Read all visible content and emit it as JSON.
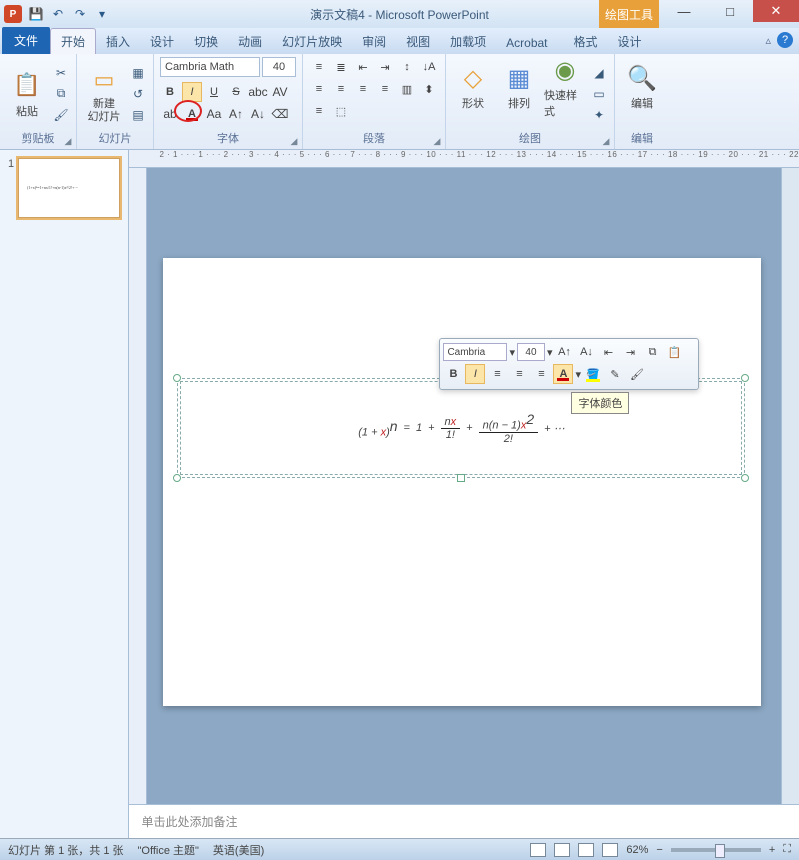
{
  "title": "演示文稿4 - Microsoft PowerPoint",
  "contextual_tab": "绘图工具",
  "tabs": {
    "file": "文件",
    "home": "开始",
    "insert": "插入",
    "design": "设计",
    "transitions": "切换",
    "animations": "动画",
    "slideshow": "幻灯片放映",
    "review": "审阅",
    "view": "视图",
    "addins": "加载项",
    "acrobat": "Acrobat",
    "format": "格式",
    "design2": "设计"
  },
  "groups": {
    "clipboard": "剪贴板",
    "slides": "幻灯片",
    "font": "字体",
    "paragraph": "段落",
    "drawing": "绘图",
    "editing": "编辑"
  },
  "buttons": {
    "paste": "粘贴",
    "newslide": "新建\n幻灯片",
    "shapes": "形状",
    "arrange": "排列",
    "quickstyles": "快速样式",
    "edit": "编辑"
  },
  "font": {
    "name": "Cambria Math",
    "size": "40"
  },
  "mini": {
    "font": "Cambria",
    "size": "40"
  },
  "tooltip": "字体颜色",
  "notes_placeholder": "单击此处添加备注",
  "status": {
    "slide": "幻灯片 第 1 张，共 1 张",
    "theme": "\"Office 主题\"",
    "lang": "英语(美国)",
    "zoom": "62%"
  },
  "thumb": {
    "num": "1"
  },
  "ruler_h": "2 · 1 · · · 1 · · · 2 · · · 3 · · · 4 · · · 5 · · · 6 · · · 7 · · · 8 · · · 9 · · · 10 · · · 11 · · · 12 · · · 13 · · · 14 · · · 15 · · · 16 · · · 17 · · · 18 · · · 19 · · · 20 · · · 21 · · · 22"
}
